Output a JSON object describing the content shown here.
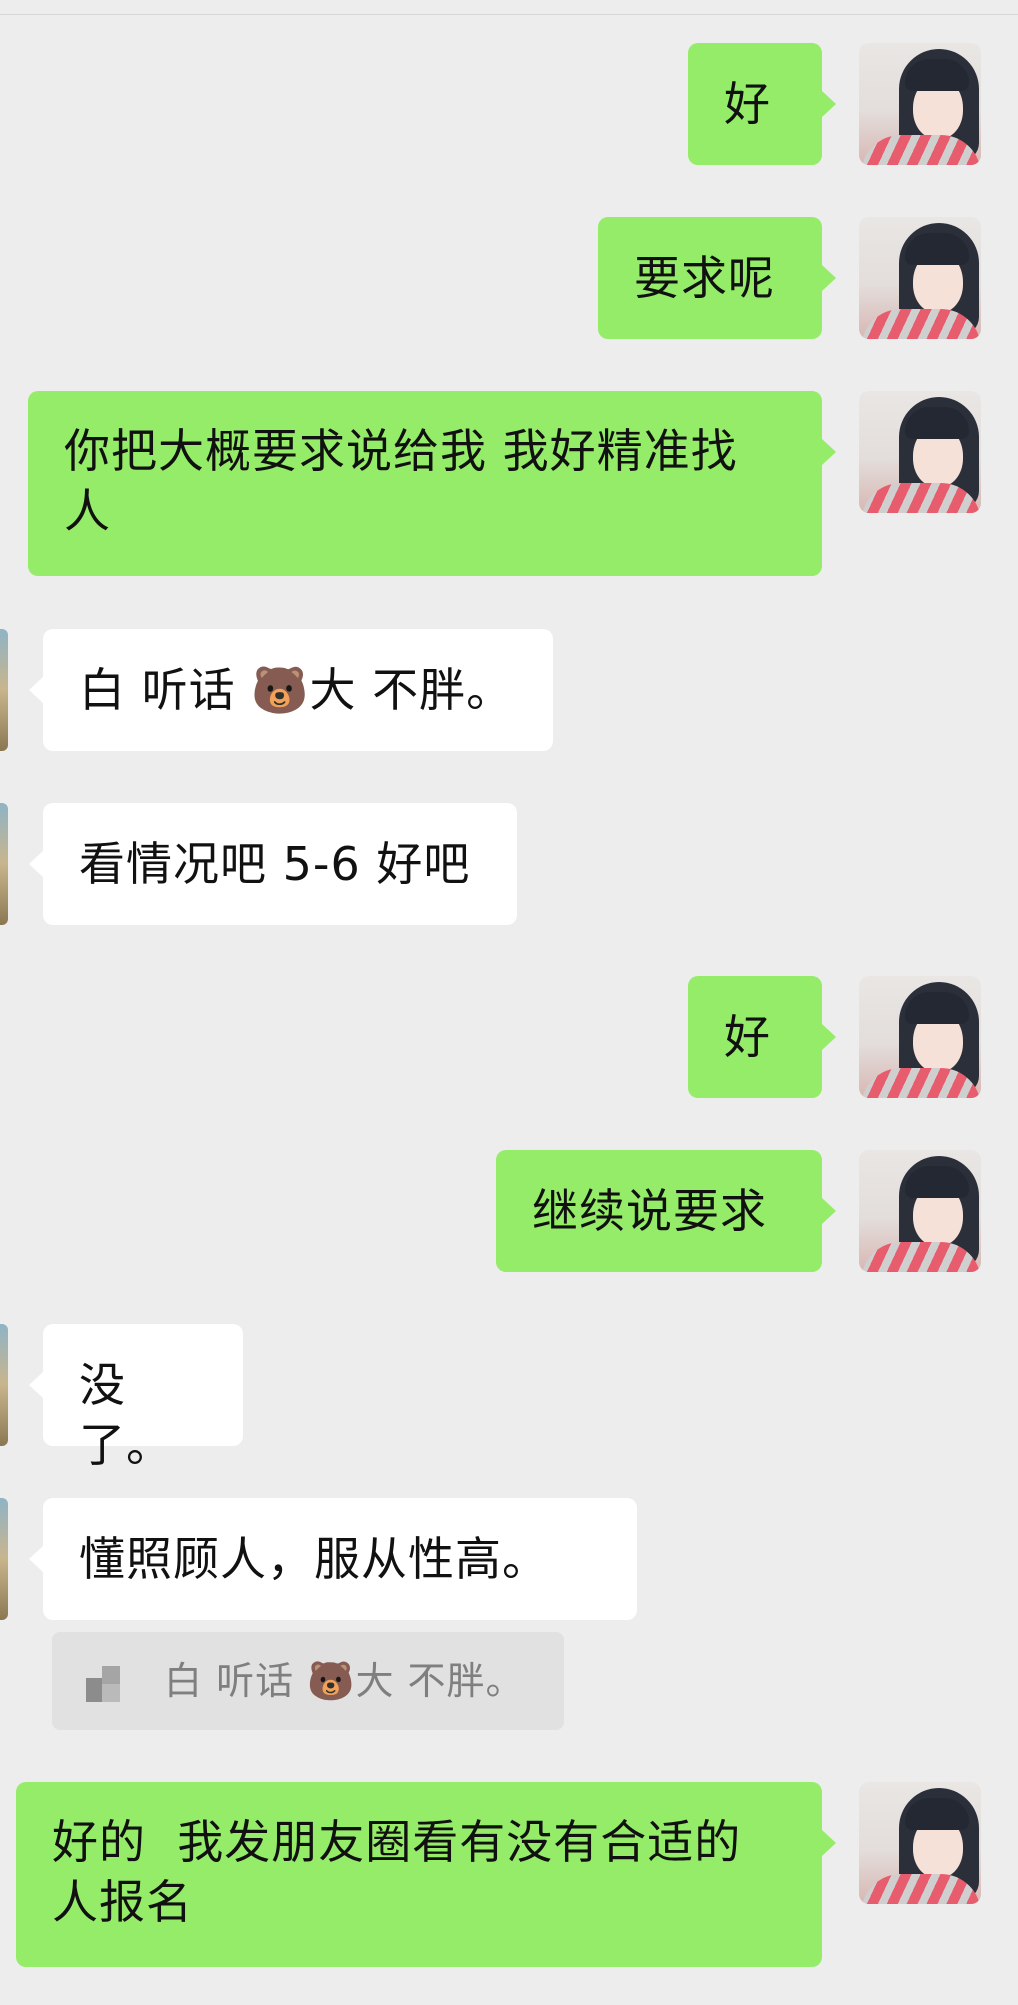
{
  "colors": {
    "background": "#ededed",
    "outgoing_bubble": "#95ec69",
    "incoming_bubble": "#ffffff",
    "quote_bg": "#e1e1e1"
  },
  "messages": [
    {
      "side": "out",
      "text": "好"
    },
    {
      "side": "out",
      "text": "要求呢"
    },
    {
      "side": "out",
      "text": "你把大概要求说给我 我好精准找\n人"
    },
    {
      "side": "in",
      "text": "白 听话 🐻大 不胖。"
    },
    {
      "side": "in",
      "text": "看情况吧 5-6 好吧"
    },
    {
      "side": "out",
      "text": "好"
    },
    {
      "side": "out",
      "text": "继续说要求"
    },
    {
      "side": "in",
      "text": "没了。"
    },
    {
      "side": "in",
      "text": "懂照顾人，服从性高。"
    },
    {
      "side": "out",
      "text": "好的  我发朋友圈看有没有合适的\n人报名"
    }
  ],
  "quote": {
    "text": "白 听话 🐻大 不胖。",
    "icon": "image-thumbnail-icon"
  }
}
